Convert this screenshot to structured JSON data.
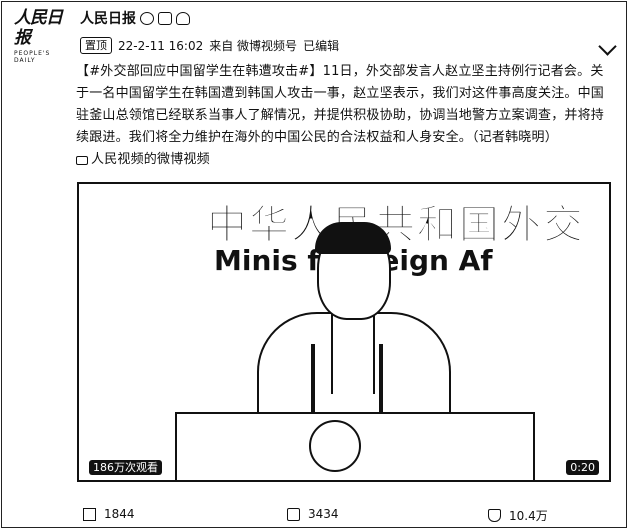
{
  "account": {
    "logo_text": "人民日报",
    "logo_sub": "PEOPLE'S DAILY",
    "name": "人民日报",
    "badges": [
      "verified-icon",
      "vip-icon",
      "fan-icon"
    ]
  },
  "meta": {
    "top_tag": "置顶",
    "timestamp": "22-2-11 16:02",
    "source": "来自 微博视频号",
    "edited": "已编辑"
  },
  "post": {
    "hashtag": "【#外交部回应中国留学生在韩遭攻击#】",
    "body": "11日，外交部发言人赵立坚主持例行记者会。关于一名中国留学生在韩国遭到韩国人攻击一事，赵立坚表示，我们对这件事高度关注。中国驻釜山总领馆已经联系当事人了解情况，并提供积极协助，协调当地警方立案调查，并将持续跟进。我们将全力维护在海外的中国公民的合法权益和人身安全。（记者韩晓明）",
    "video_link": "人民视频的微博视频"
  },
  "video": {
    "stage_cn": "中华人民共和国外交",
    "stage_en": "Minis   f Foreign Af",
    "views": "186万次观看",
    "duration": "0:20"
  },
  "footer": {
    "shares": "1844",
    "comments": "3434",
    "likes": "10.4万"
  }
}
